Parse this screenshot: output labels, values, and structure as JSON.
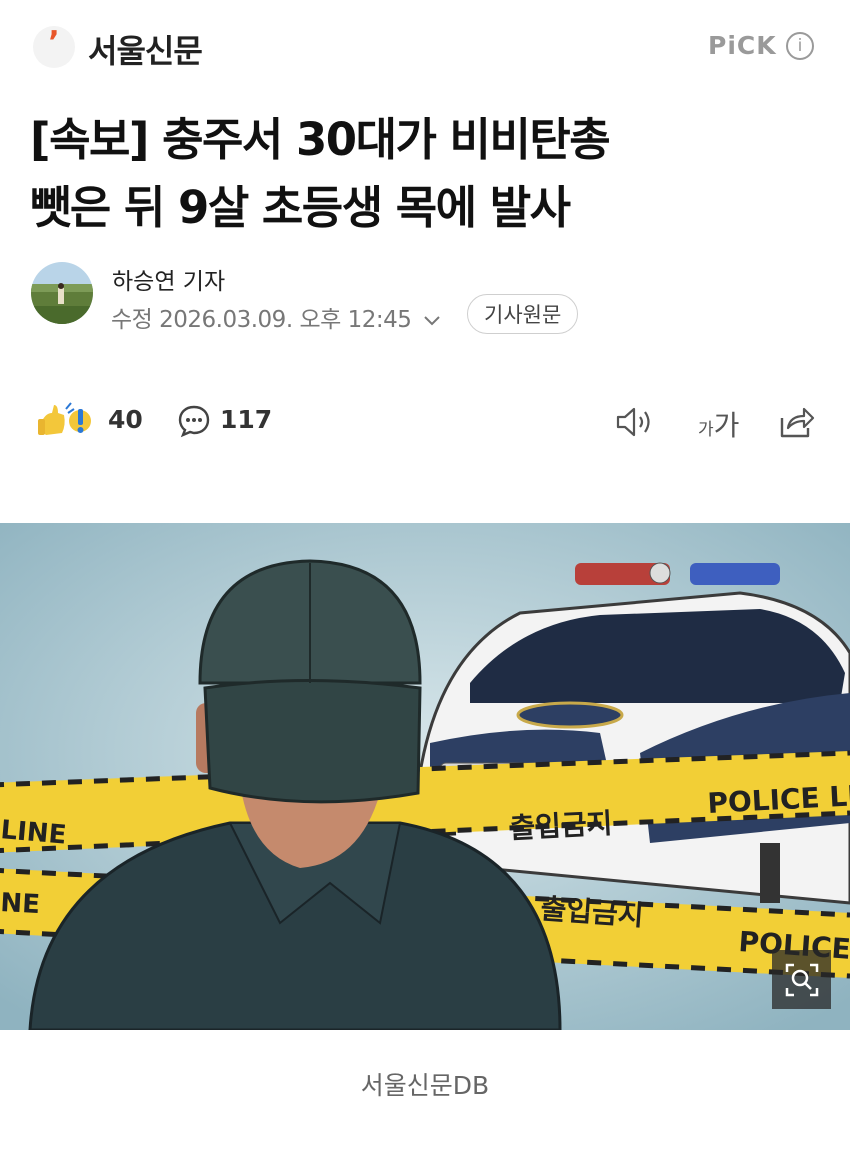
{
  "header": {
    "logo_glyph": "ʼ",
    "press_name": "서울신문",
    "pick_label": "PiCK",
    "info_icon": "i"
  },
  "article": {
    "headline_line1": "[속보] 충주서 30대가 비비탄총",
    "headline_line2": "뺏은 뒤 9살 초등생 목에 발사",
    "reporter": "하승연 기자",
    "meta": "수정 2026.03.09. 오후 12:45",
    "origin_button": "기사원문"
  },
  "reactions": {
    "reaction_count": "40",
    "comment_count": "117",
    "font_small": "가",
    "font_large": "가"
  },
  "image": {
    "tape_words": [
      "POLICE LINE",
      "출입금지",
      "LINE",
      "NE"
    ],
    "caption": "서울신문DB"
  },
  "colors": {
    "brand_accent": "#e8562a",
    "tape_yellow": "#f2cf36",
    "background_blue": "#b5cfd8"
  }
}
